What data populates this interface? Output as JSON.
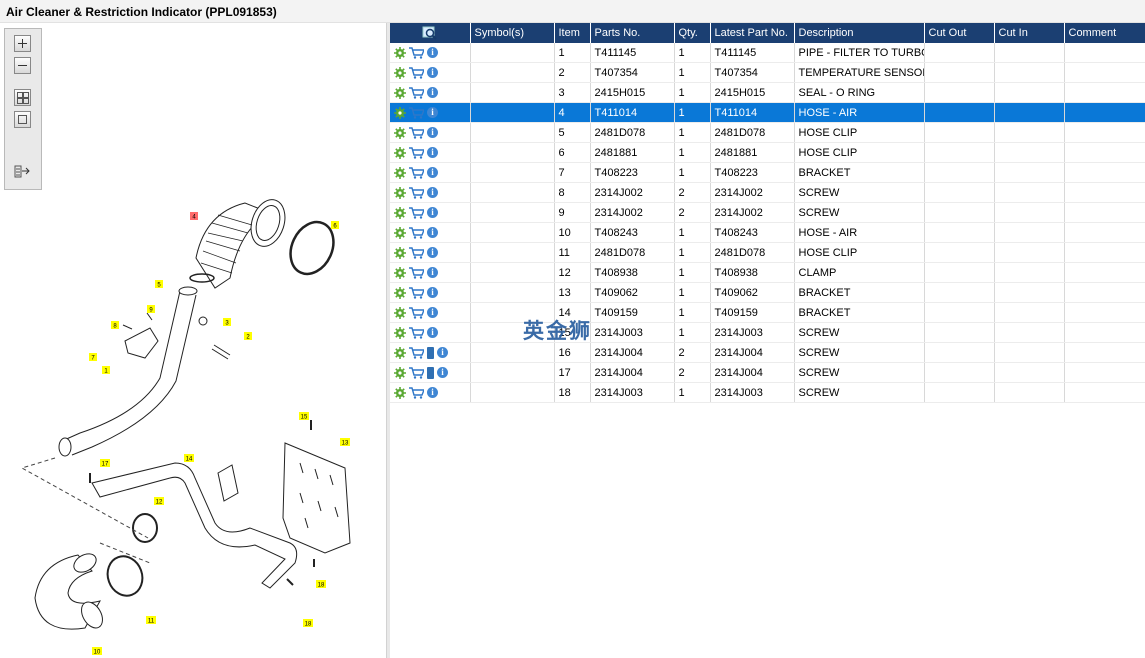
{
  "window": {
    "title": "Air Cleaner & Restriction Indicator (PPL091853)"
  },
  "diagram": {
    "zoom_tools": [
      {
        "name": "zoom-in-icon"
      },
      {
        "name": "zoom-out-icon"
      },
      {
        "name": "fit-to-window-icon"
      },
      {
        "name": "actual-size-icon"
      },
      {
        "name": "export-icon"
      }
    ],
    "callouts": {
      "c1": "1",
      "c2": "2",
      "c3": "3",
      "c4": "4",
      "c5": "5",
      "c6": "6",
      "c7": "7",
      "c8": "8",
      "c9": "9",
      "c10": "10",
      "c11": "11",
      "c12": "12",
      "c13": "13",
      "c14": "14",
      "c15": "15",
      "c16": "16",
      "c17": "17",
      "c18a": "18",
      "c18b": "18"
    },
    "highlight_color": "#ffff00",
    "selected_callout_color": "#ff6b6b"
  },
  "table": {
    "headers": {
      "search": "",
      "symbols": "Symbol(s)",
      "item": "Item",
      "parts_no": "Parts No.",
      "qty": "Qty.",
      "latest": "Latest Part No.",
      "description": "Description",
      "cut_out": "Cut Out",
      "cut_in": "Cut In",
      "comment": "Comment"
    },
    "rows": [
      {
        "item": "1",
        "parts_no": "T411145",
        "qty": "1",
        "latest": "T411145",
        "description": "PIPE - FILTER TO TURBO",
        "cut_out": "",
        "cut_in": "",
        "comment": "",
        "book": false
      },
      {
        "item": "2",
        "parts_no": "T407354",
        "qty": "1",
        "latest": "T407354",
        "description": "TEMPERATURE SENSOR",
        "cut_out": "",
        "cut_in": "",
        "comment": "",
        "book": false
      },
      {
        "item": "3",
        "parts_no": "2415H015",
        "qty": "1",
        "latest": "2415H015",
        "description": "SEAL - O RING",
        "cut_out": "",
        "cut_in": "",
        "comment": "",
        "book": false
      },
      {
        "item": "4",
        "parts_no": "T411014",
        "qty": "1",
        "latest": "T411014",
        "description": "HOSE - AIR",
        "cut_out": "",
        "cut_in": "",
        "comment": "",
        "book": false
      },
      {
        "item": "5",
        "parts_no": "2481D078",
        "qty": "1",
        "latest": "2481D078",
        "description": "HOSE CLIP",
        "cut_out": "",
        "cut_in": "",
        "comment": "",
        "book": false
      },
      {
        "item": "6",
        "parts_no": "2481881",
        "qty": "1",
        "latest": "2481881",
        "description": "HOSE CLIP",
        "cut_out": "",
        "cut_in": "",
        "comment": "",
        "book": false
      },
      {
        "item": "7",
        "parts_no": "T408223",
        "qty": "1",
        "latest": "T408223",
        "description": "BRACKET",
        "cut_out": "",
        "cut_in": "",
        "comment": "",
        "book": false
      },
      {
        "item": "8",
        "parts_no": "2314J002",
        "qty": "2",
        "latest": "2314J002",
        "description": "SCREW",
        "cut_out": "",
        "cut_in": "",
        "comment": "",
        "book": false
      },
      {
        "item": "9",
        "parts_no": "2314J002",
        "qty": "2",
        "latest": "2314J002",
        "description": "SCREW",
        "cut_out": "",
        "cut_in": "",
        "comment": "",
        "book": false
      },
      {
        "item": "10",
        "parts_no": "T408243",
        "qty": "1",
        "latest": "T408243",
        "description": "HOSE - AIR",
        "cut_out": "",
        "cut_in": "",
        "comment": "",
        "book": false
      },
      {
        "item": "11",
        "parts_no": "2481D078",
        "qty": "1",
        "latest": "2481D078",
        "description": "HOSE CLIP",
        "cut_out": "",
        "cut_in": "",
        "comment": "",
        "book": false
      },
      {
        "item": "12",
        "parts_no": "T408938",
        "qty": "1",
        "latest": "T408938",
        "description": "CLAMP",
        "cut_out": "",
        "cut_in": "",
        "comment": "",
        "book": false
      },
      {
        "item": "13",
        "parts_no": "T409062",
        "qty": "1",
        "latest": "T409062",
        "description": "BRACKET",
        "cut_out": "",
        "cut_in": "",
        "comment": "",
        "book": false
      },
      {
        "item": "14",
        "parts_no": "T409159",
        "qty": "1",
        "latest": "T409159",
        "description": "BRACKET",
        "cut_out": "",
        "cut_in": "",
        "comment": "",
        "book": false
      },
      {
        "item": "15",
        "parts_no": "2314J003",
        "qty": "1",
        "latest": "2314J003",
        "description": "SCREW",
        "cut_out": "",
        "cut_in": "",
        "comment": "",
        "book": false
      },
      {
        "item": "16",
        "parts_no": "2314J004",
        "qty": "2",
        "latest": "2314J004",
        "description": "SCREW",
        "cut_out": "",
        "cut_in": "",
        "comment": "",
        "book": true
      },
      {
        "item": "17",
        "parts_no": "2314J004",
        "qty": "2",
        "latest": "2314J004",
        "description": "SCREW",
        "cut_out": "",
        "cut_in": "",
        "comment": "",
        "book": true
      },
      {
        "item": "18",
        "parts_no": "2314J003",
        "qty": "1",
        "latest": "2314J003",
        "description": "SCREW",
        "cut_out": "",
        "cut_in": "",
        "comment": "",
        "book": false
      }
    ],
    "selected_row_index": 3,
    "colors": {
      "header_bg": "#1b3f72",
      "selected_bg": "#0a78d7"
    }
  },
  "watermark": {
    "text": "英金狮"
  }
}
